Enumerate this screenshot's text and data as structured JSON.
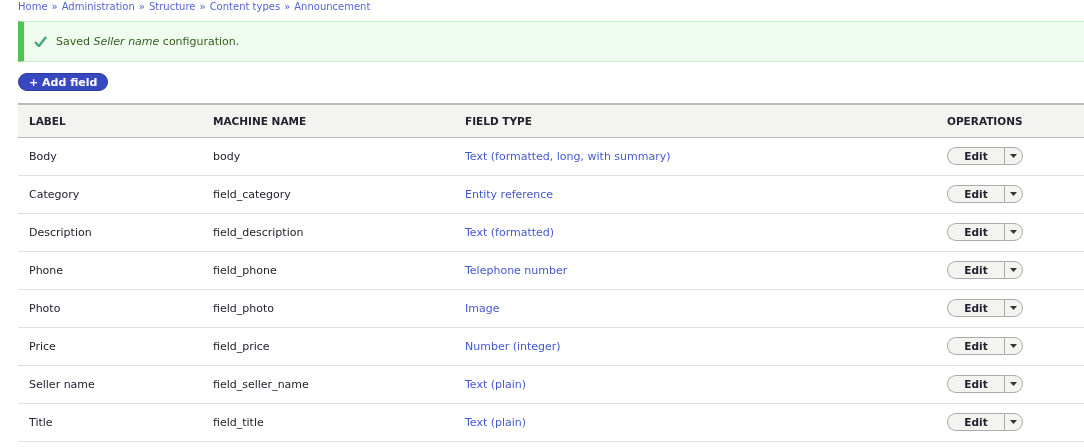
{
  "breadcrumb": {
    "separator": "»",
    "items": [
      "Home",
      "Administration",
      "Structure",
      "Content types",
      "Announcement"
    ]
  },
  "message": {
    "text": "Saved *Seller name* configuration."
  },
  "add_button": "+ Add field",
  "table": {
    "columns": [
      "LABEL",
      "MACHINE NAME",
      "FIELD TYPE",
      "OPERATIONS"
    ],
    "rows": [
      {
        "label": "Body",
        "machine_name": "body",
        "field_type": "Text (formatted, long, with summary)",
        "operation": "Edit"
      },
      {
        "label": "Category",
        "machine_name": "field_category",
        "field_type": "Entity reference",
        "operation": "Edit"
      },
      {
        "label": "Description",
        "machine_name": "field_description",
        "field_type": "Text (formatted)",
        "operation": "Edit"
      },
      {
        "label": "Phone",
        "machine_name": "field_phone",
        "field_type": "Telephone number",
        "operation": "Edit"
      },
      {
        "label": "Photo",
        "machine_name": "field_photo",
        "field_type": "Image",
        "operation": "Edit"
      },
      {
        "label": "Price",
        "machine_name": "field_price",
        "field_type": "Number (integer)",
        "operation": "Edit"
      },
      {
        "label": "Seller name",
        "machine_name": "field_seller_name",
        "field_type": "Text (plain)",
        "operation": "Edit"
      },
      {
        "label": "Title",
        "machine_name": "field_title",
        "field_type": "Text (plain)",
        "operation": "Edit"
      }
    ]
  }
}
